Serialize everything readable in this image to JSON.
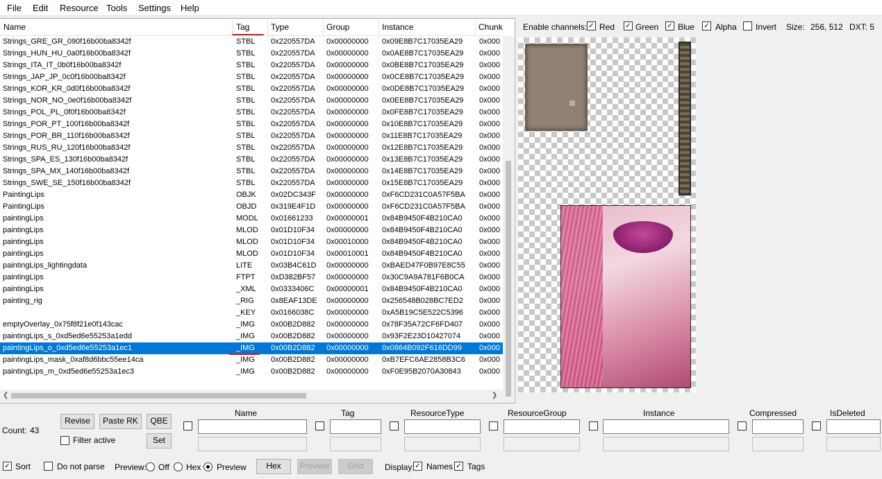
{
  "menu": [
    "File",
    "Edit",
    "Resource",
    "Tools",
    "Settings",
    "Help"
  ],
  "columns": {
    "name": "Name",
    "tag": "Tag",
    "type": "Type",
    "group": "Group",
    "instance": "Instance",
    "chunk": "Chunk"
  },
  "rows": [
    {
      "name": "Strings_GRE_GR_090f16b00ba8342f",
      "tag": "STBL",
      "type": "0x220557DA",
      "group": "0x00000000",
      "instance": "0x09E8B7C17035EA29",
      "chunk": "0x000"
    },
    {
      "name": "Strings_HUN_HU_0a0f16b00ba8342f",
      "tag": "STBL",
      "type": "0x220557DA",
      "group": "0x00000000",
      "instance": "0x0AE8B7C17035EA29",
      "chunk": "0x000"
    },
    {
      "name": "Strings_ITA_IT_0b0f16b00ba8342f",
      "tag": "STBL",
      "type": "0x220557DA",
      "group": "0x00000000",
      "instance": "0x0BE8B7C17035EA29",
      "chunk": "0x000"
    },
    {
      "name": "Strings_JAP_JP_0c0f16b00ba8342f",
      "tag": "STBL",
      "type": "0x220557DA",
      "group": "0x00000000",
      "instance": "0x0CE8B7C17035EA29",
      "chunk": "0x000"
    },
    {
      "name": "Strings_KOR_KR_0d0f16b00ba8342f",
      "tag": "STBL",
      "type": "0x220557DA",
      "group": "0x00000000",
      "instance": "0x0DE8B7C17035EA29",
      "chunk": "0x000"
    },
    {
      "name": "Strings_NOR_NO_0e0f16b00ba8342f",
      "tag": "STBL",
      "type": "0x220557DA",
      "group": "0x00000000",
      "instance": "0x0EE8B7C17035EA29",
      "chunk": "0x000"
    },
    {
      "name": "Strings_POL_PL_0f0f16b00ba8342f",
      "tag": "STBL",
      "type": "0x220557DA",
      "group": "0x00000000",
      "instance": "0x0FE8B7C17035EA29",
      "chunk": "0x000"
    },
    {
      "name": "Strings_POR_PT_100f16b00ba8342f",
      "tag": "STBL",
      "type": "0x220557DA",
      "group": "0x00000000",
      "instance": "0x10E8B7C17035EA29",
      "chunk": "0x000"
    },
    {
      "name": "Strings_POR_BR_110f16b00ba8342f",
      "tag": "STBL",
      "type": "0x220557DA",
      "group": "0x00000000",
      "instance": "0x11E8B7C17035EA29",
      "chunk": "0x000"
    },
    {
      "name": "Strings_RUS_RU_120f16b00ba8342f",
      "tag": "STBL",
      "type": "0x220557DA",
      "group": "0x00000000",
      "instance": "0x12E8B7C17035EA29",
      "chunk": "0x000"
    },
    {
      "name": "Strings_SPA_ES_130f16b00ba8342f",
      "tag": "STBL",
      "type": "0x220557DA",
      "group": "0x00000000",
      "instance": "0x13E8B7C17035EA29",
      "chunk": "0x000"
    },
    {
      "name": "Strings_SPA_MX_140f16b00ba8342f",
      "tag": "STBL",
      "type": "0x220557DA",
      "group": "0x00000000",
      "instance": "0x14E8B7C17035EA29",
      "chunk": "0x000"
    },
    {
      "name": "Strings_SWE_SE_150f16b00ba8342f",
      "tag": "STBL",
      "type": "0x220557DA",
      "group": "0x00000000",
      "instance": "0x15E8B7C17035EA29",
      "chunk": "0x000"
    },
    {
      "name": "PaintingLips",
      "tag": "OBJK",
      "type": "0x02DC343F",
      "group": "0x00000000",
      "instance": "0xF6CD231C0A57F5BA",
      "chunk": "0x000"
    },
    {
      "name": "PaintingLips",
      "tag": "OBJD",
      "type": "0x319E4F1D",
      "group": "0x00000000",
      "instance": "0xF6CD231C0A57F5BA",
      "chunk": "0x000"
    },
    {
      "name": "paintingLips",
      "tag": "MODL",
      "type": "0x01661233",
      "group": "0x00000001",
      "instance": "0x84B9450F4B210CA0",
      "chunk": "0x000"
    },
    {
      "name": "paintingLips",
      "tag": "MLOD",
      "type": "0x01D10F34",
      "group": "0x00000000",
      "instance": "0x84B9450F4B210CA0",
      "chunk": "0x000"
    },
    {
      "name": "paintingLips",
      "tag": "MLOD",
      "type": "0x01D10F34",
      "group": "0x00010000",
      "instance": "0x84B9450F4B210CA0",
      "chunk": "0x000"
    },
    {
      "name": "paintingLips",
      "tag": "MLOD",
      "type": "0x01D10F34",
      "group": "0x00010001",
      "instance": "0x84B9450F4B210CA0",
      "chunk": "0x000"
    },
    {
      "name": "paintingLips_lightingdata",
      "tag": "LITE",
      "type": "0x03B4C61D",
      "group": "0x00000000",
      "instance": "0xBAED47F0B97E8C55",
      "chunk": "0x000"
    },
    {
      "name": "paintingLips",
      "tag": "FTPT",
      "type": "0xD382BF57",
      "group": "0x00000000",
      "instance": "0x30C9A9A781F6B0CA",
      "chunk": "0x000"
    },
    {
      "name": "paintingLips",
      "tag": "_XML",
      "type": "0x0333406C",
      "group": "0x00000001",
      "instance": "0x84B9450F4B210CA0",
      "chunk": "0x000"
    },
    {
      "name": "painting_rig",
      "tag": "_RIG",
      "type": "0x8EAF13DE",
      "group": "0x00000000",
      "instance": "0x256548B028BC7ED2",
      "chunk": "0x000"
    },
    {
      "name": "",
      "tag": "_KEY",
      "type": "0x0166038C",
      "group": "0x00000000",
      "instance": "0xA5B19C5E522C5396",
      "chunk": "0x000"
    },
    {
      "name": "emptyOverlay_0x75f8f21e0f143cac",
      "tag": "_IMG",
      "type": "0x00B2D882",
      "group": "0x00000000",
      "instance": "0x78F35A72CF6FD407",
      "chunk": "0x000"
    },
    {
      "name": "paintingLips_s_0xd5ed6e55253a1edd",
      "tag": "_IMG",
      "type": "0x00B2D882",
      "group": "0x00000000",
      "instance": "0x93F2E23D10427074",
      "chunk": "0x000"
    },
    {
      "name": "paintingLips_o_0xd5ed6e55253a1ec1",
      "tag": "_IMG",
      "type": "0x00B2D882",
      "group": "0x00000000",
      "instance": "0x0864B092F616DD99",
      "chunk": "0x000"
    },
    {
      "name": "paintingLips_mask_0xaf8d6bbc55ee14ca",
      "tag": "_IMG",
      "type": "0x00B2D882",
      "group": "0x00000000",
      "instance": "0xB7EFC6AE2858B3C6",
      "chunk": "0x000"
    },
    {
      "name": "paintingLips_m_0xd5ed6e55253a1ec3",
      "tag": "_IMG",
      "type": "0x00B2D882",
      "group": "0x00000000",
      "instance": "0xF0E95B2070A30843",
      "chunk": "0x000"
    }
  ],
  "selected_row": 26,
  "preview": {
    "enable_label": "Enable channels:",
    "red": "Red",
    "green": "Green",
    "blue": "Blue",
    "alpha": "Alpha",
    "invert": "Invert",
    "size_label": "Size:",
    "size_value": "256, 512",
    "dxt": "DXT: 5"
  },
  "bottom": {
    "count_label": "Count:",
    "count_value": "43",
    "revise": "Revise",
    "paste_rk": "Paste RK",
    "qbe": "QBE",
    "set": "Set",
    "filter_active": "Filter active",
    "filter_cols": [
      "Name",
      "Tag",
      "ResourceType",
      "ResourceGroup",
      "Instance",
      "Compressed",
      "IsDeleted"
    ],
    "sort": "Sort",
    "do_not_parse": "Do not parse",
    "preview_label": "Preview:",
    "off": "Off",
    "hex_radio": "Hex",
    "preview_radio": "Preview",
    "hex_btn": "Hex",
    "preview_btn": "Preview",
    "grid_btn": "Grid",
    "display_label": "Display:",
    "names": "Names",
    "tags": "Tags"
  },
  "colors": {
    "selection": "#0078d7",
    "annotation": "#d01818"
  }
}
